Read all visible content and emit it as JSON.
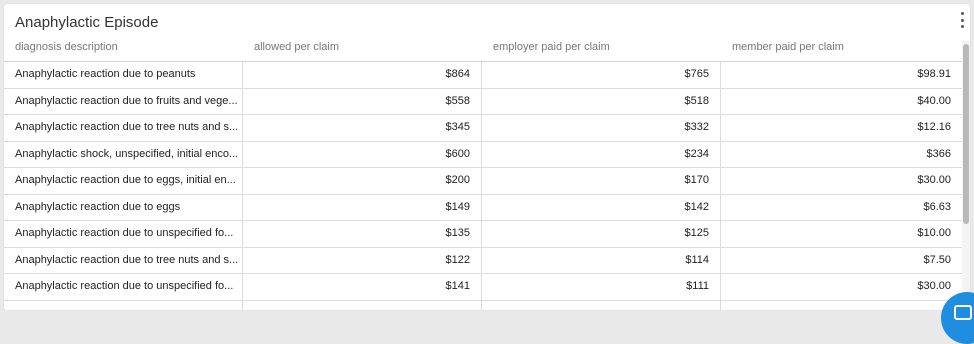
{
  "card": {
    "title": "Anaphylactic Episode"
  },
  "table": {
    "headers": [
      "diagnosis description",
      "allowed per claim",
      "employer paid per claim",
      "member paid per claim"
    ],
    "rows": [
      [
        "Anaphylactic reaction due to peanuts",
        "$864",
        "$765",
        "$98.91"
      ],
      [
        "Anaphylactic reaction due to fruits and vege...",
        "$558",
        "$518",
        "$40.00"
      ],
      [
        "Anaphylactic reaction due to tree nuts and s...",
        "$345",
        "$332",
        "$12.16"
      ],
      [
        "Anaphylactic shock, unspecified, initial enco...",
        "$600",
        "$234",
        "$366"
      ],
      [
        "Anaphylactic reaction due to eggs, initial en...",
        "$200",
        "$170",
        "$30.00"
      ],
      [
        "Anaphylactic reaction due to eggs",
        "$149",
        "$142",
        "$6.63"
      ],
      [
        "Anaphylactic reaction due to unspecified fo...",
        "$135",
        "$125",
        "$10.00"
      ],
      [
        "Anaphylactic reaction due to tree nuts and s...",
        "$122",
        "$114",
        "$7.50"
      ],
      [
        "Anaphylactic reaction due to unspecified fo...",
        "$141",
        "$111",
        "$30.00"
      ]
    ]
  },
  "icons": {
    "menu": "kebab-menu-icon",
    "chat": "chat-bubble-icon"
  },
  "colors": {
    "chat_button": "#1f8de0",
    "background": "#e9e9e9"
  }
}
